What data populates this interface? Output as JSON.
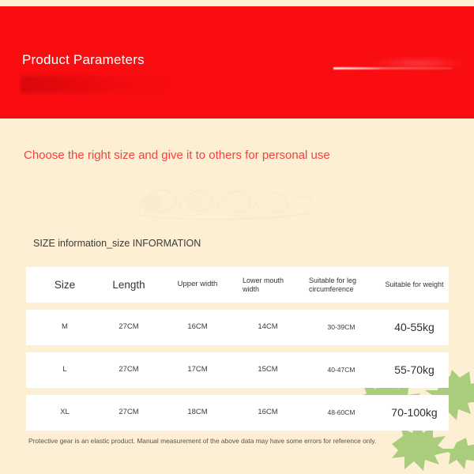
{
  "banner": {
    "title": "Product Parameters",
    "background_color": "#f90d11",
    "title_color": "#ffffff"
  },
  "page": {
    "background_color": "#fcefd4",
    "subtitle": "Choose the right size and give it to others for personal use",
    "subtitle_color": "#f8403f",
    "size_info_caption": "SIZE information_size INFORMATION"
  },
  "decor": {
    "leaf_color": "#a9cd7d",
    "leaf_icon": "leaf-icon",
    "watermark_icon": "watermark-flourish-icon",
    "streak_icon": "light-streak-icon"
  },
  "size_table": {
    "headers": [
      "Size",
      "Length",
      "Upper width",
      "Lower mouth width",
      "Suitable for leg circumference",
      "Suitable for weight"
    ],
    "rows": [
      {
        "size": "M",
        "length": "27CM",
        "upper_width": "16CM",
        "lower_mouth_width": "14CM",
        "leg_circumference": "30-39CM",
        "weight": "40-55kg"
      },
      {
        "size": "L",
        "length": "27CM",
        "upper_width": "17CM",
        "lower_mouth_width": "15CM",
        "leg_circumference": "40-47CM",
        "weight": "55-70kg"
      },
      {
        "size": "XL",
        "length": "27CM",
        "upper_width": "18CM",
        "lower_mouth_width": "16CM",
        "leg_circumference": "48-60CM",
        "weight": "70-100kg"
      }
    ]
  },
  "disclaimer": "Protective gear is an elastic product. Manual measurement of the above data may have some errors for reference only."
}
